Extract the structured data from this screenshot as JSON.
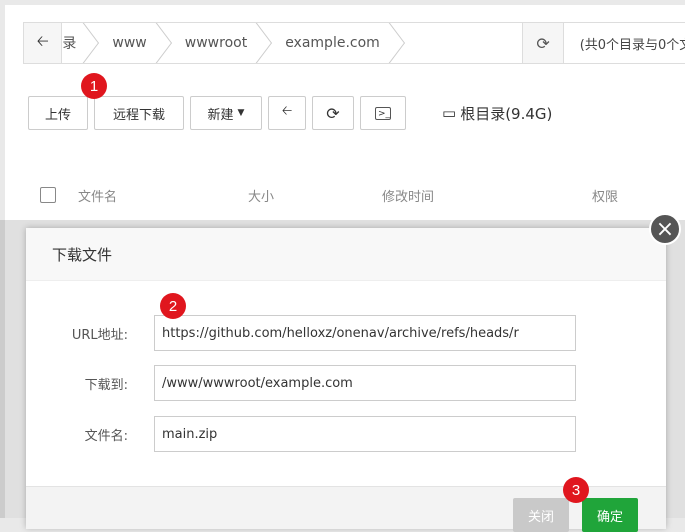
{
  "path_bar": {
    "back_icon": "arrow-left-icon",
    "crumbs": [
      "录",
      "www",
      "wwwroot",
      "example.com"
    ],
    "refresh_icon": "refresh-icon",
    "count_text": "(共0个目录与0个文"
  },
  "toolbar": {
    "upload_label": "上传",
    "remote_download_label": "远程下载",
    "new_label": "新建",
    "disk_label": "根目录(9.4G)"
  },
  "table_header": {
    "columns": [
      "文件名",
      "大小",
      "修改时间",
      "权限"
    ]
  },
  "dialog": {
    "title": "下载文件",
    "fields": [
      {
        "label": "URL地址:",
        "value": "https://github.com/helloxz/onenav/archive/refs/heads/r"
      },
      {
        "label": "下载到:",
        "value": "/www/wwwroot/example.com"
      },
      {
        "label": "文件名:",
        "value": "main.zip"
      }
    ],
    "close_button_label": "关闭",
    "confirm_button_label": "确定"
  },
  "badges": [
    "1",
    "2",
    "3"
  ],
  "colors": {
    "confirm_green": "#20a53a",
    "badge_red": "#e0161e"
  }
}
